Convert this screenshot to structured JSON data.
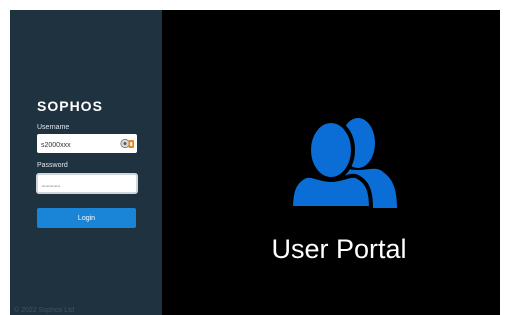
{
  "brand": {
    "name": "SOPHOS"
  },
  "login_form": {
    "username_label": "Username",
    "username_value": "s2000xxx",
    "password_label": "Password",
    "password_value": "··············",
    "login_button_label": "Login"
  },
  "footer": {
    "copyright": "© 2022 Sophos Ltd"
  },
  "hero": {
    "title": "User Portal",
    "icon": "users-icon"
  },
  "colors": {
    "sidebar_bg": "#1f3240",
    "main_bg": "#000000",
    "accent": "#1a85d6",
    "icon_blue": "#0b6ed6"
  }
}
